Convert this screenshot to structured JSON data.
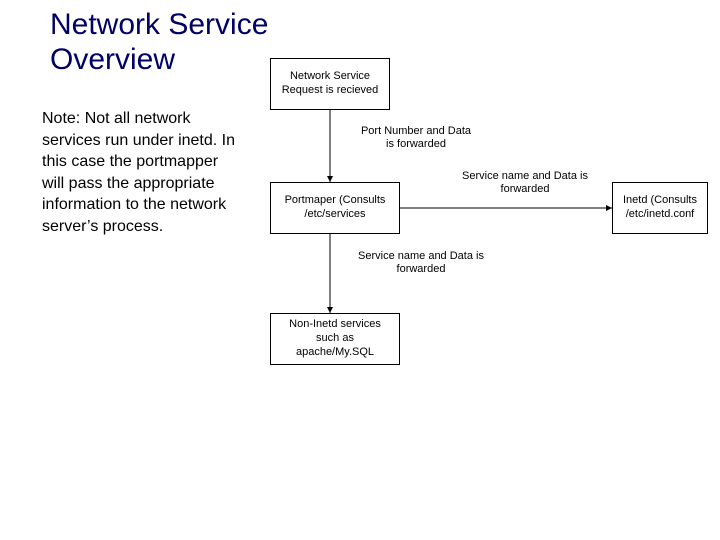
{
  "title_line1": "Network Service",
  "title_line2": "Overview",
  "note_text": "Note: Not all network services run under inetd. In this case the portmapper will pass the appropriate information to the network server’s process.",
  "diagram": {
    "nodes": {
      "request": "Network Service Request is recieved",
      "portmapper": "Portmaper (Consults /etc/services",
      "inetd": "Inetd (Consults /etc/inetd.conf",
      "noninetd": "Non-Inetd services such as apache/My.SQL"
    },
    "edges": {
      "req_to_pm": "Port Number and Data is forwarded",
      "pm_to_inetd": "Service name and Data is forwarded",
      "pm_to_non": "Service name and Data is forwarded"
    }
  }
}
